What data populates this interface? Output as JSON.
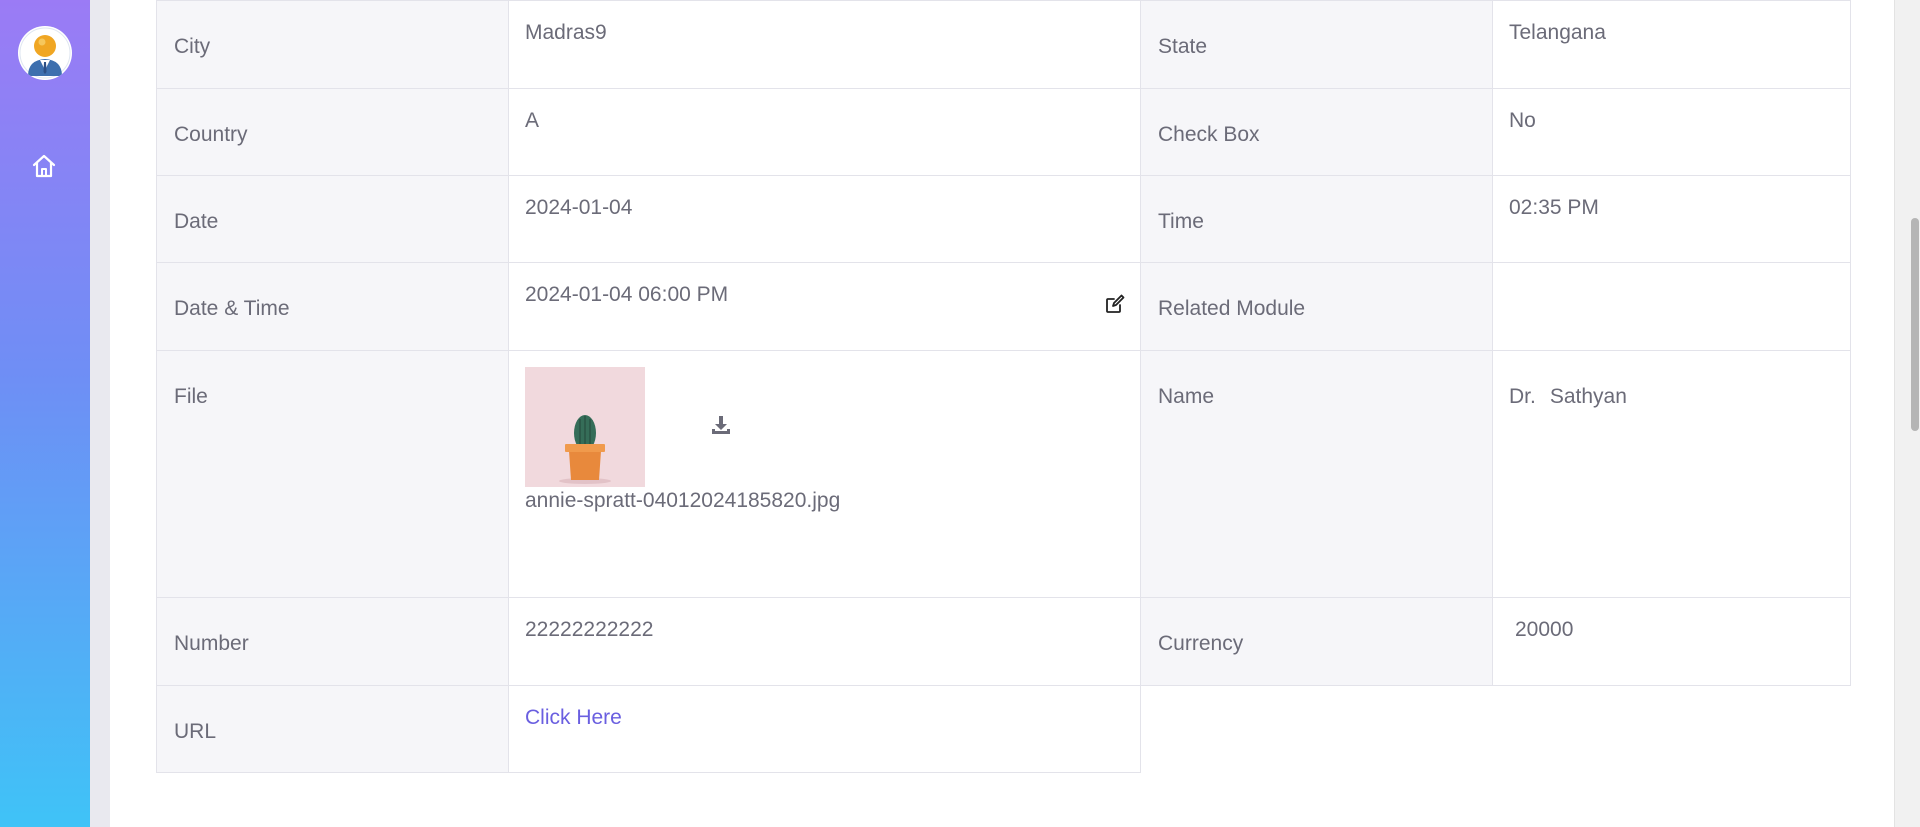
{
  "sidebar": {
    "avatar_icon": "user-avatar-icon",
    "home_icon": "home-icon",
    "gradient": [
      "#9b7bf5",
      "#6f8ef5",
      "#3fc3f7"
    ]
  },
  "details": {
    "city": {
      "label": "City",
      "value": "Madras9"
    },
    "state": {
      "label": "State",
      "value": "Telangana"
    },
    "country": {
      "label": "Country",
      "value": "A"
    },
    "checkbox": {
      "label": "Check Box",
      "value": "No"
    },
    "date": {
      "label": "Date",
      "value": "2024-01-04"
    },
    "time": {
      "label": "Time",
      "value": "02:35 PM"
    },
    "datetime": {
      "label": "Date & Time",
      "value": "2024-01-04 06:00 PM",
      "edit_icon": "edit-icon"
    },
    "related_module": {
      "label": "Related Module",
      "value": ""
    },
    "file": {
      "label": "File",
      "file_name": "annie-spratt-04012024185820.jpg",
      "download_icon": "download-icon"
    },
    "name": {
      "label": "Name",
      "salutation": "Dr.",
      "value": "Sathyan"
    },
    "number": {
      "label": "Number",
      "value": "22222222222"
    },
    "currency": {
      "label": "Currency",
      "value": "20000"
    },
    "url": {
      "label": "URL",
      "link_text": "Click Here"
    }
  },
  "colors": {
    "link": "#6a5fe0",
    "label_bg": "#f6f6f9",
    "text": "#6b6b78"
  }
}
